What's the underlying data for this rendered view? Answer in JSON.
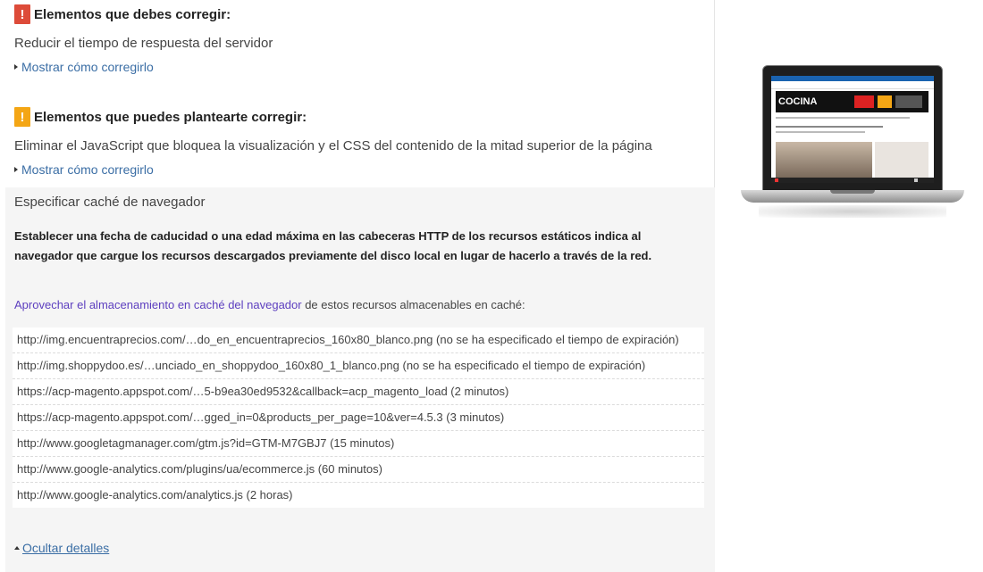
{
  "sections": {
    "must_fix": {
      "badge": "!",
      "title": "Elementos que debes corregir:",
      "rule": "Reducir el tiempo de respuesta del servidor",
      "toggle": "Mostrar cómo corregirlo"
    },
    "consider_fix": {
      "badge": "!",
      "title": "Elementos que puedes plantearte corregir:",
      "rule": "Eliminar el JavaScript que bloquea la visualización y el CSS del contenido de la mitad superior de la página",
      "toggle": "Mostrar cómo corregirlo"
    }
  },
  "details": {
    "title": "Especificar caché de navegador",
    "description": "Establecer una fecha de caducidad o una edad máxima en las cabeceras HTTP de los recursos estáticos indica al navegador que cargue los recursos descargados previamente del disco local en lugar de hacerlo a través de la red.",
    "intro_link": "Aprovechar el almacenamiento en caché del navegador",
    "intro_text": " de estos recursos almacenables en caché:",
    "resources": [
      "http://img.encuentraprecios.com/…do_en_encuentraprecios_160x80_blanco.png (no se ha especificado el tiempo de expiración)",
      "http://img.shoppydoo.es/…unciado_en_shoppydoo_160x80_1_blanco.png (no se ha especificado el tiempo de expiración)",
      "https://acp-magento.appspot.com/…5-b9ea30ed9532&callback=acp_magento_load (2 minutos)",
      "https://acp-magento.appspot.com/…gged_in=0&products_per_page=10&ver=4.5.3 (3 minutos)",
      "http://www.googletagmanager.com/gtm.js?id=GTM-M7GBJ7 (15 minutos)",
      "http://www.google-analytics.com/plugins/ua/ecommerce.js (60 minutos)",
      "http://www.google-analytics.com/analytics.js (2 horas)"
    ],
    "hide_label": "Ocultar detalles"
  },
  "preview": {
    "banner_text": "COCINA"
  },
  "colors": {
    "error": "#dd4b39",
    "warning": "#f4a615",
    "link": "#3b6ea5",
    "link_visited": "#5d3fbf"
  }
}
